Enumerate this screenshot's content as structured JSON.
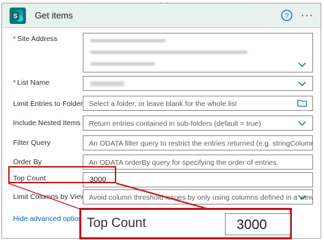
{
  "header": {
    "title": "Get items",
    "colors": {
      "header_bg": "#e7f1ee",
      "sharepoint": "#03787c"
    }
  },
  "fields": {
    "site_address": {
      "label": "Site Address",
      "required_mark": "*",
      "value_line1": "DfV Holiday Bookings -",
      "value_line2": "https://contoso.sharepoint.com/sites/digital-",
      "value_line3": "dev/HolidayBookings"
    },
    "list_name": {
      "label": "List Name",
      "required_mark": "*"
    },
    "limit_entries": {
      "label": "Limit Entries to Folder",
      "placeholder": "Select a folder, or leave blank for the whole list"
    },
    "include_nested": {
      "label": "Include Nested Items",
      "placeholder": "Return entries contained in sub-folders (default = true)"
    },
    "filter_query": {
      "label": "Filter Query",
      "placeholder": "An ODATA filter query to restrict the entries returned (e.g. stringColumn eq 'stri"
    },
    "order_by": {
      "label": "Order By",
      "placeholder": "An ODATA orderBy query for specifying the order of entries."
    },
    "top_count": {
      "label": "Top Count",
      "value": "3000"
    },
    "limit_columns": {
      "label": "Limit Columns by View",
      "placeholder": "Avoid column threshold issues by only using columns defined in a view"
    }
  },
  "hide_advanced": "Hide advanced options",
  "zoom": {
    "label": "Top Count",
    "value": "3000",
    "highlight_color": "#c4161c"
  },
  "icons": [
    "sharepoint-logo",
    "help-icon",
    "more-icon",
    "chevron-down-icon",
    "folder-icon"
  ]
}
